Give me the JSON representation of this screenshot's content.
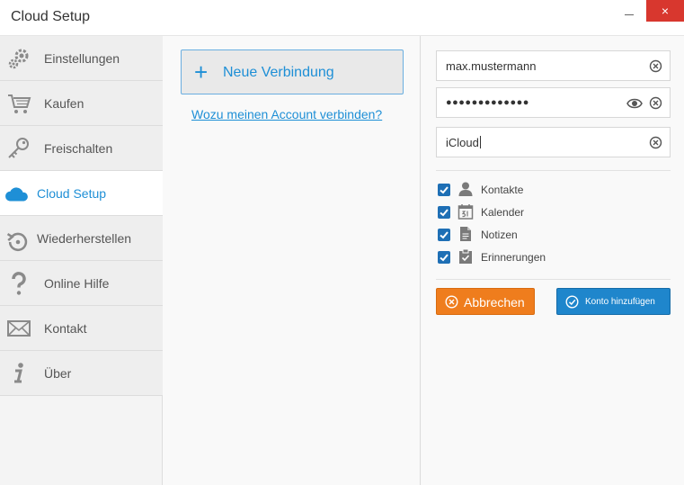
{
  "window": {
    "title": "Cloud Setup",
    "close_glyph": "×"
  },
  "sidebar": {
    "items": [
      {
        "label": "Einstellungen",
        "icon": "gears-icon"
      },
      {
        "label": "Kaufen",
        "icon": "cart-icon"
      },
      {
        "label": "Freischalten",
        "icon": "key-icon"
      },
      {
        "label": "Cloud Setup",
        "icon": "cloud-icon",
        "active": true
      },
      {
        "label": "Wiederherstellen",
        "icon": "restore-icon"
      },
      {
        "label": "Online Hilfe",
        "icon": "question-icon"
      },
      {
        "label": "Kontakt",
        "icon": "envelope-icon"
      },
      {
        "label": "Über",
        "icon": "info-icon"
      }
    ]
  },
  "middle": {
    "new_connection_label": "Neue Verbindung",
    "new_connection_glyph": "+",
    "why_link": "Wozu meinen Account verbinden?"
  },
  "form": {
    "username": "max.mustermann",
    "password_mask": "●●●●●●●●●●●●●",
    "provider": "iCloud",
    "options": [
      {
        "label": "Kontakte",
        "icon": "person-icon",
        "checked": true
      },
      {
        "label": "Kalender",
        "icon": "calendar-icon",
        "checked": true
      },
      {
        "label": "Notizen",
        "icon": "note-icon",
        "checked": true
      },
      {
        "label": "Erinnerungen",
        "icon": "clipboard-check-icon",
        "checked": true
      }
    ],
    "cancel_label": "Abbrechen",
    "add_label": "Konto hinzufügen"
  },
  "colors": {
    "accent": "#1e8fd6",
    "cancel": "#ef7d1d",
    "add": "#1f86cc",
    "close": "#d8372e",
    "checkbox": "#1e6fb5"
  }
}
